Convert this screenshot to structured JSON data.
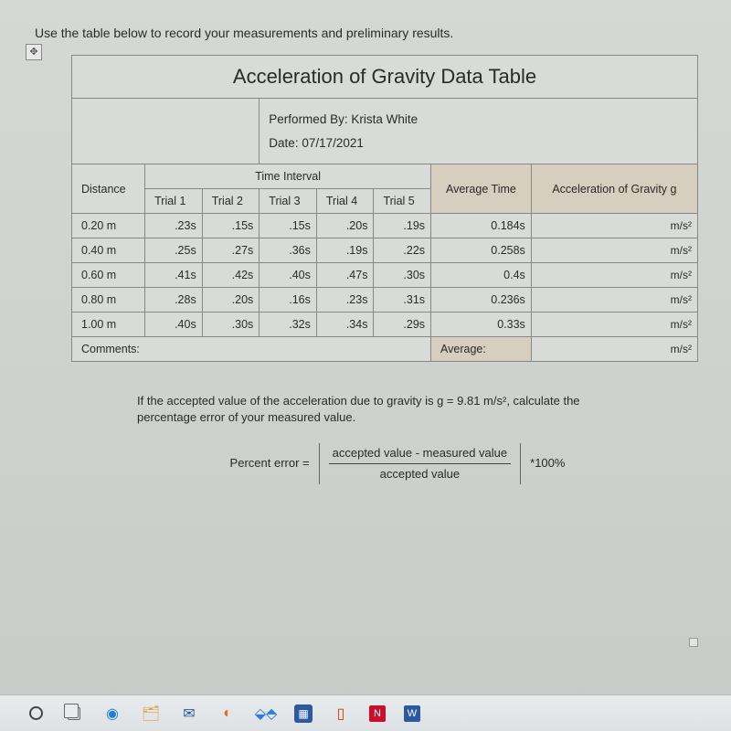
{
  "instruction": "Use the table below to record your measurements and preliminary results.",
  "table": {
    "title": "Acceleration of Gravity Data Table",
    "performed_by_label": "Performed By:",
    "performed_by": "Krista White",
    "date_label": "Date:",
    "date": "07/17/2021",
    "headers": {
      "time_interval": "Time Interval",
      "avg_time": "Average Time",
      "accel": "Acceleration of Gravity g",
      "distance": "Distance",
      "trial1": "Trial 1",
      "trial2": "Trial 2",
      "trial3": "Trial 3",
      "trial4": "Trial 4",
      "trial5": "Trial 5"
    },
    "rows": [
      {
        "distance": "0.20 m",
        "t1": ".23s",
        "t2": ".15s",
        "t3": ".15s",
        "t4": ".20s",
        "t5": ".19s",
        "avg": "0.184s",
        "accel": "m/s²"
      },
      {
        "distance": "0.40 m",
        "t1": ".25s",
        "t2": ".27s",
        "t3": ".36s",
        "t4": ".19s",
        "t5": ".22s",
        "avg": "0.258s",
        "accel": "m/s²"
      },
      {
        "distance": "0.60 m",
        "t1": ".41s",
        "t2": ".42s",
        "t3": ".40s",
        "t4": ".47s",
        "t5": ".30s",
        "avg": "0.4s",
        "accel": "m/s²"
      },
      {
        "distance": "0.80 m",
        "t1": ".28s",
        "t2": ".20s",
        "t3": ".16s",
        "t4": ".23s",
        "t5": ".31s",
        "avg": "0.236s",
        "accel": "m/s²"
      },
      {
        "distance": "1.00 m",
        "t1": ".40s",
        "t2": ".30s",
        "t3": ".32s",
        "t4": ".34s",
        "t5": ".29s",
        "avg": "0.33s",
        "accel": "m/s²"
      }
    ],
    "comments_label": "Comments:",
    "average_label": "Average:",
    "average_unit": "m/s²"
  },
  "below": {
    "text_line1": "If the accepted value of the acceleration due to gravity is g = 9.81 m/s², calculate the",
    "text_line2": "percentage error of your measured value.",
    "pe_label": "Percent error =",
    "frac_top": "accepted value - measured value",
    "frac_bot": "accepted value",
    "times": "*100%"
  },
  "taskbar": {
    "items": [
      "circle",
      "task-view",
      "edge",
      "explorer",
      "mail",
      "firefox",
      "dropbox",
      "word-blue",
      "office",
      "netflix",
      "word"
    ]
  },
  "chart_data": {
    "type": "table",
    "title": "Acceleration of Gravity Data Table",
    "columns": [
      "Distance",
      "Trial 1",
      "Trial 2",
      "Trial 3",
      "Trial 4",
      "Trial 5",
      "Average Time",
      "Acceleration of Gravity g"
    ],
    "rows": [
      [
        "0.20 m",
        0.23,
        0.15,
        0.15,
        0.2,
        0.19,
        0.184,
        null
      ],
      [
        "0.40 m",
        0.25,
        0.27,
        0.36,
        0.19,
        0.22,
        0.258,
        null
      ],
      [
        "0.60 m",
        0.41,
        0.42,
        0.4,
        0.47,
        0.3,
        0.4,
        null
      ],
      [
        "0.80 m",
        0.28,
        0.2,
        0.16,
        0.23,
        0.31,
        0.236,
        null
      ],
      [
        "1.00 m",
        0.4,
        0.3,
        0.32,
        0.34,
        0.29,
        0.33,
        null
      ]
    ],
    "units": {
      "trials": "s",
      "average": "s",
      "acceleration": "m/s²"
    },
    "accepted_g": 9.81
  }
}
